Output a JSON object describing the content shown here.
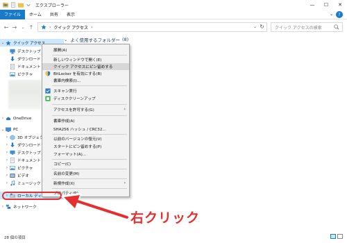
{
  "window": {
    "title": "エクスプローラー",
    "controls": {
      "minimize": "—",
      "maximize": "☐",
      "close": "✕"
    }
  },
  "ribbon": {
    "tabs": [
      "ファイル",
      "ホーム",
      "共有",
      "表示"
    ],
    "help": "?",
    "collapse": "⌄"
  },
  "address": {
    "back": "←",
    "forward": "→",
    "recent": "⌄",
    "up": "↑",
    "path": "クイック アクセス",
    "sep": "›",
    "dropdown": "⌄",
    "refresh": "↻"
  },
  "search": {
    "placeholder": "クイック アクセスの検索"
  },
  "content": {
    "chevron": "⌄",
    "group_title": "よく使用するフォルダー",
    "group_count": "(8)"
  },
  "nav": {
    "quick_access": "クイック アクセス",
    "quick_items": [
      "デスクトップ",
      "ダウンロード",
      "ドキュメント",
      "ピクチャ"
    ],
    "onedrive": "OneDrive",
    "pc": "PC",
    "pc_items": [
      "3D オブジェクト",
      "ダウンロード",
      "デスクトップ",
      "ドキュメント",
      "ピクチャ",
      "ビデオ",
      "ミュージック",
      "ローカル ディス"
    ],
    "network": "ネットワーク",
    "chevron_collapsed": "›",
    "chevron_expanded": "⌄"
  },
  "context_menu": {
    "items": [
      "展開(A)",
      "新しいウィンドウで開く(E)",
      "クイック アクセスにピン留めする",
      "BitLocker を有効にする(B)",
      "書庫内検索(I)...",
      "スキャン実行",
      "ディスククリーンアップ",
      "アクセスを許可する(G)",
      "書庫作成(A)",
      "SHA256 ハッシュ / CRC32...",
      "以前のバージョンの復元(V)",
      "スタートにピン留めする(P)",
      "フォーマット(A)...",
      "コピー(C)",
      "名前の変更(M)",
      "新規作成(X)",
      "プロパティ(R)"
    ],
    "submenu_arrow": "›"
  },
  "status": {
    "text": "28 個の項目"
  },
  "annotation": {
    "text": "右クリック",
    "color": "#e52e2e"
  },
  "colors": {
    "accent": "#1979ca",
    "selected": "#cce8ff",
    "highlight": "#d8d8d8"
  }
}
